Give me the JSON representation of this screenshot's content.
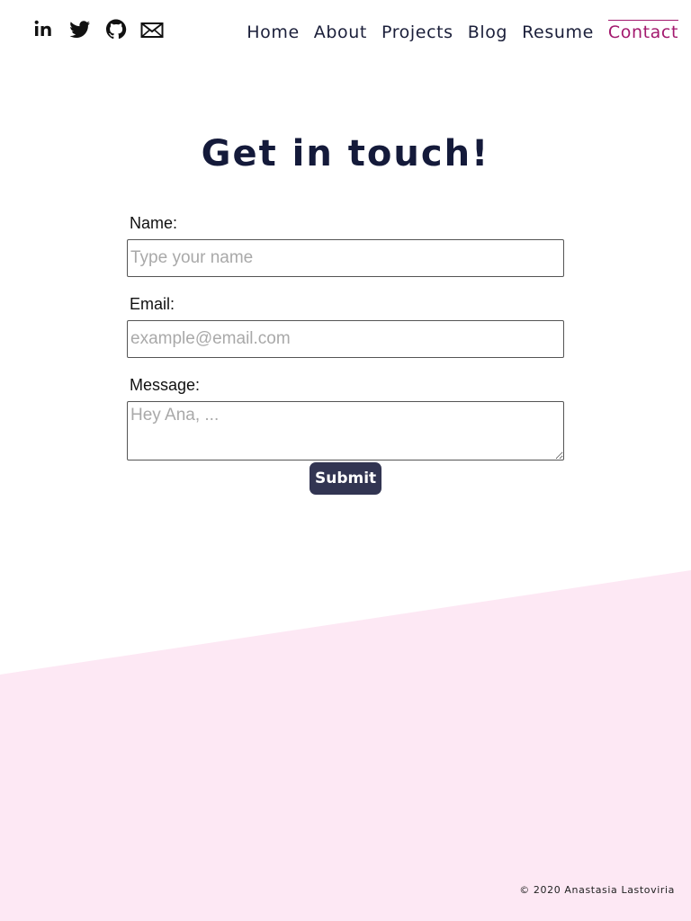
{
  "social": [
    {
      "name": "linkedin-icon"
    },
    {
      "name": "twitter-icon"
    },
    {
      "name": "github-icon"
    },
    {
      "name": "email-icon"
    }
  ],
  "nav": {
    "home": "Home",
    "about": "About",
    "projects": "Projects",
    "blog": "Blog",
    "resume": "Resume",
    "contact": "Contact",
    "active": "Contact"
  },
  "heading": "Get in touch!",
  "form": {
    "name_label": "Name:",
    "name_placeholder": "Type your name",
    "name_value": "",
    "email_label": "Email:",
    "email_placeholder": "example@email.com",
    "email_value": "",
    "message_label": "Message:",
    "message_placeholder": "Hey Ana, ...",
    "message_value": "",
    "submit_label": "Submit"
  },
  "footer": "© 2020 Anastasia Lastoviria",
  "colors": {
    "nav_text": "#1b1f3a",
    "accent": "#a3196e",
    "heading": "#141a3a",
    "button_bg": "#323552",
    "footer_bg": "#fde8f4"
  }
}
